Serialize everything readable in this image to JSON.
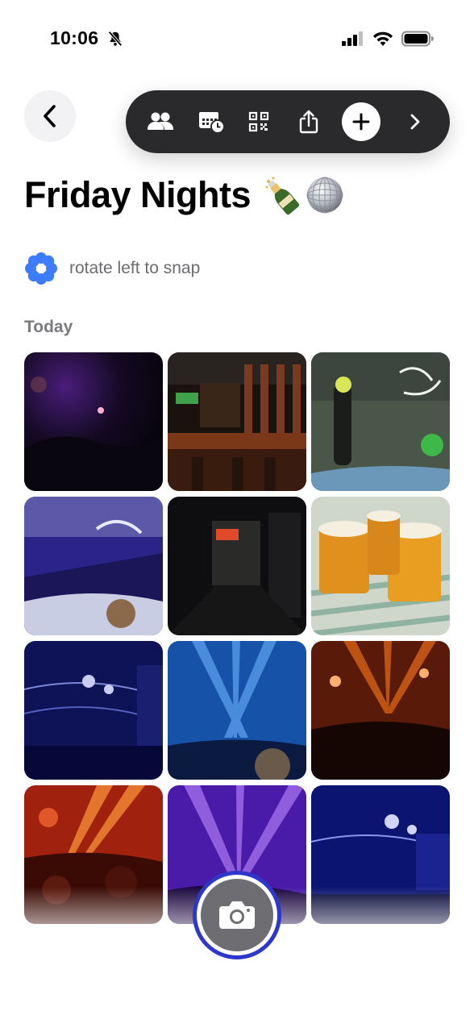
{
  "status_bar": {
    "time": "10:06",
    "icons": [
      "bell-slash-icon",
      "cellular-signal-icon",
      "wifi-icon",
      "battery-icon"
    ]
  },
  "nav": {
    "back_icon": "chevron-left-icon"
  },
  "toolbar": {
    "items": [
      "people-icon",
      "calendar-clock-icon",
      "qr-code-icon",
      "share-icon",
      "plus-icon",
      "chevron-right-icon"
    ]
  },
  "album": {
    "title": "Friday Nights",
    "title_emoji": [
      "champagne-bottle",
      "disco-ball"
    ]
  },
  "hint": {
    "icon": "flower-snap-icon",
    "text": "rotate left to snap",
    "accent_color": "#3d7bff"
  },
  "section": {
    "label": "Today"
  },
  "photos": [
    {
      "subject": "dark club crowd purple lights"
    },
    {
      "subject": "bar with bottles and wooden stools"
    },
    {
      "subject": "DJ on stage with neon sign"
    },
    {
      "subject": "stage with purple lights and neon sign"
    },
    {
      "subject": "dark hallway interior"
    },
    {
      "subject": "three glasses of beer on table"
    },
    {
      "subject": "club with blue lights and disco balls"
    },
    {
      "subject": "concert with blue light beams"
    },
    {
      "subject": "crowd under orange lights"
    },
    {
      "subject": "crowd under red and orange lights"
    },
    {
      "subject": "purple laser beams over crowd"
    },
    {
      "subject": "club with blue lights and disco balls"
    }
  ],
  "camera": {
    "icon": "camera-icon",
    "ring_color": "#2d37c9"
  }
}
